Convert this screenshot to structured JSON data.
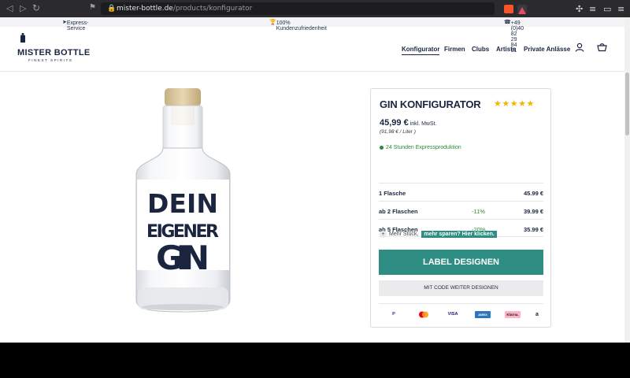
{
  "browser": {
    "url_domain": "mister-bottle.de",
    "url_path": "/products/konfigurator"
  },
  "topbar": {
    "express": "Express-Service",
    "satisfaction": "100% Kundenzufriedenheit",
    "phone": "+49 (0)40 82 29 84 51"
  },
  "header": {
    "logo_name": "MISTER BOTTLE",
    "logo_sub": "FINEST SPIRITS",
    "menu": [
      "Konfigurator",
      "Firmen",
      "Clubs",
      "Artists",
      "Private Anlässe"
    ]
  },
  "product": {
    "label_line1": "DEIN",
    "label_line2": "EIGENER",
    "label_line3": "GIN"
  },
  "configurator": {
    "title": "GIN KONFIGURATOR",
    "stars": "★★★★★",
    "price": "45,99 €",
    "vat": "inkl. MwSt.",
    "per_liter": "(91,98 € / Liter )",
    "express": "24 Stunden Expressproduktion",
    "tiers": [
      {
        "label": "1  Flasche",
        "discount": "",
        "price": "45.99 €"
      },
      {
        "label": "ab 2 Flaschen",
        "discount": "-11%",
        "price": "39.99 €"
      },
      {
        "label": "ab 5 Flaschen",
        "discount": "-20%",
        "price": "35.99 €"
      }
    ],
    "more_text": "Mehr Stück,",
    "more_link": "mehr sparen? Hier klicken.",
    "btn_design": "LABEL DESIGNEN",
    "btn_code": "MIT CODE WEITER DESIGNEN",
    "payments": [
      "P",
      "",
      "VISA",
      "AMEX",
      "Klarna.",
      "a"
    ]
  },
  "colors": {
    "accent": "#2e8e83",
    "navy": "#1b2540",
    "stars": "#f4b400"
  }
}
